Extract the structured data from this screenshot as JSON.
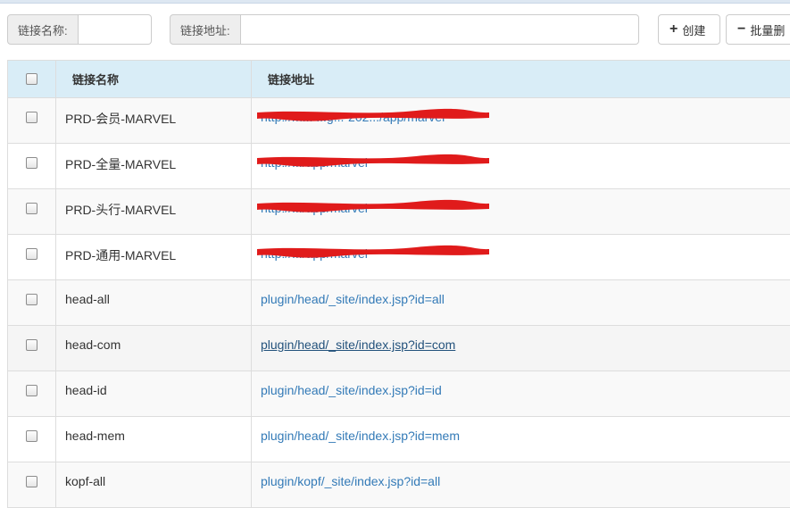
{
  "toolbar": {
    "name_label": "链接名称:",
    "name_value": "",
    "url_label": "链接地址:",
    "url_value": "",
    "create_label": "创建",
    "batch_delete_label": "批量删"
  },
  "table": {
    "headers": {
      "name": "链接名称",
      "url": "链接地址"
    },
    "rows": [
      {
        "name": "PRD-会员-MARVEL",
        "url": "http://m... ...g...-202.../app/marvel",
        "redacted": true
      },
      {
        "name": "PRD-全量-MARVEL",
        "url": "http://.../app/marvel",
        "redacted": true
      },
      {
        "name": "PRD-头行-MARVEL",
        "url": "http://.../app/marvel",
        "redacted": true
      },
      {
        "name": "PRD-通用-MARVEL",
        "url": "http://.../app/marvel",
        "redacted": true
      },
      {
        "name": "head-all",
        "url": "plugin/head/_site/index.jsp?id=all",
        "redacted": false
      },
      {
        "name": "head-com",
        "url": "plugin/head/_site/index.jsp?id=com",
        "redacted": false,
        "hover": true
      },
      {
        "name": "head-id",
        "url": "plugin/head/_site/index.jsp?id=id",
        "redacted": false
      },
      {
        "name": "head-mem",
        "url": "plugin/head/_site/index.jsp?id=mem",
        "redacted": false
      },
      {
        "name": "kopf-all",
        "url": "plugin/kopf/_site/index.jsp?id=all",
        "redacted": false
      }
    ]
  },
  "colors": {
    "header_bg": "#d9edf7",
    "link": "#337ab7",
    "redaction": "#e01b1b"
  },
  "icons": {
    "create": "plus-icon",
    "batch_delete": "minus-icon"
  }
}
